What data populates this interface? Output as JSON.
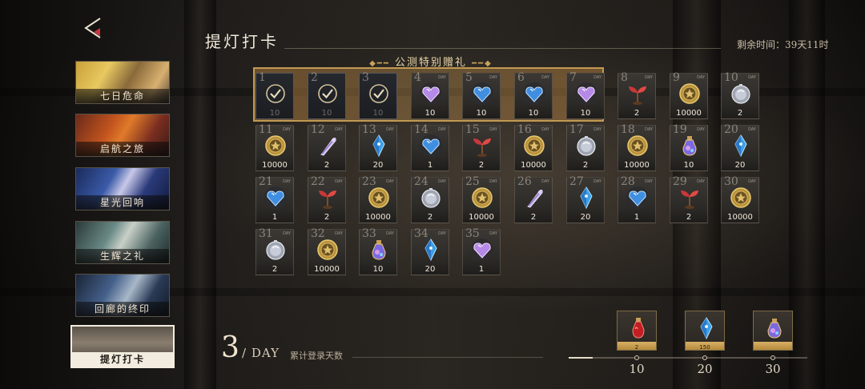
{
  "sidebar": {
    "items": [
      {
        "label": "七日危命",
        "active": false
      },
      {
        "label": "启航之旅",
        "active": false
      },
      {
        "label": "星光回响",
        "active": false
      },
      {
        "label": "生辉之礼",
        "active": false
      },
      {
        "label": "回廊的终印",
        "active": false
      },
      {
        "label": "提灯打卡",
        "active": true
      }
    ]
  },
  "header": {
    "title": "提灯打卡",
    "time_left": "剩余时间：39天11时"
  },
  "special": {
    "title": "公测特别赠礼"
  },
  "rewards": [
    {
      "day": "1",
      "qty": "10",
      "item": "check",
      "claimed": true
    },
    {
      "day": "2",
      "qty": "10",
      "item": "check",
      "claimed": true
    },
    {
      "day": "3",
      "qty": "10",
      "item": "check",
      "claimed": true
    },
    {
      "day": "4",
      "qty": "10",
      "item": "purple-heart"
    },
    {
      "day": "5",
      "qty": "10",
      "item": "blue-heart"
    },
    {
      "day": "6",
      "qty": "10",
      "item": "blue-heart"
    },
    {
      "day": "7",
      "qty": "10",
      "item": "purple-heart"
    },
    {
      "day": "8",
      "qty": "2",
      "item": "red-sprout"
    },
    {
      "day": "9",
      "qty": "10000",
      "item": "gold-coin"
    },
    {
      "day": "10",
      "qty": "2",
      "item": "silver-orb"
    },
    {
      "day": "11",
      "qty": "10000",
      "item": "gold-coin"
    },
    {
      "day": "12",
      "qty": "2",
      "item": "quill"
    },
    {
      "day": "13",
      "qty": "20",
      "item": "blue-crystal"
    },
    {
      "day": "14",
      "qty": "1",
      "item": "blue-heart"
    },
    {
      "day": "15",
      "qty": "2",
      "item": "red-sprout"
    },
    {
      "day": "16",
      "qty": "10000",
      "item": "gold-coin"
    },
    {
      "day": "17",
      "qty": "2",
      "item": "silver-orb"
    },
    {
      "day": "18",
      "qty": "10000",
      "item": "gold-coin"
    },
    {
      "day": "19",
      "qty": "10",
      "item": "potion"
    },
    {
      "day": "20",
      "qty": "20",
      "item": "blue-crystal"
    },
    {
      "day": "21",
      "qty": "1",
      "item": "blue-heart"
    },
    {
      "day": "22",
      "qty": "2",
      "item": "red-sprout"
    },
    {
      "day": "23",
      "qty": "10000",
      "item": "gold-coin"
    },
    {
      "day": "24",
      "qty": "2",
      "item": "silver-orb"
    },
    {
      "day": "25",
      "qty": "10000",
      "item": "gold-coin"
    },
    {
      "day": "26",
      "qty": "2",
      "item": "quill"
    },
    {
      "day": "27",
      "qty": "20",
      "item": "blue-crystal"
    },
    {
      "day": "28",
      "qty": "1",
      "item": "blue-heart"
    },
    {
      "day": "29",
      "qty": "2",
      "item": "red-sprout"
    },
    {
      "day": "30",
      "qty": "10000",
      "item": "gold-coin"
    },
    {
      "day": "31",
      "qty": "2",
      "item": "silver-orb"
    },
    {
      "day": "32",
      "qty": "10000",
      "item": "gold-coin"
    },
    {
      "day": "33",
      "qty": "10",
      "item": "potion"
    },
    {
      "day": "34",
      "qty": "20",
      "item": "blue-crystal"
    },
    {
      "day": "35",
      "qty": "1",
      "item": "purple-heart"
    }
  ],
  "day_tag": "DAY",
  "progress": {
    "days": "3",
    "unit": "/ DAY",
    "label": "累计登录天数",
    "fraction": 0.1,
    "milestones": [
      {
        "day": "10",
        "qty": "2",
        "item": "red-potion"
      },
      {
        "day": "20",
        "qty": "150",
        "item": "blue-crystal"
      },
      {
        "day": "30",
        "qty": "",
        "item": "potion"
      }
    ]
  },
  "colors": {
    "accent": "#c19a52",
    "claimed_check": "#d4c39d"
  }
}
